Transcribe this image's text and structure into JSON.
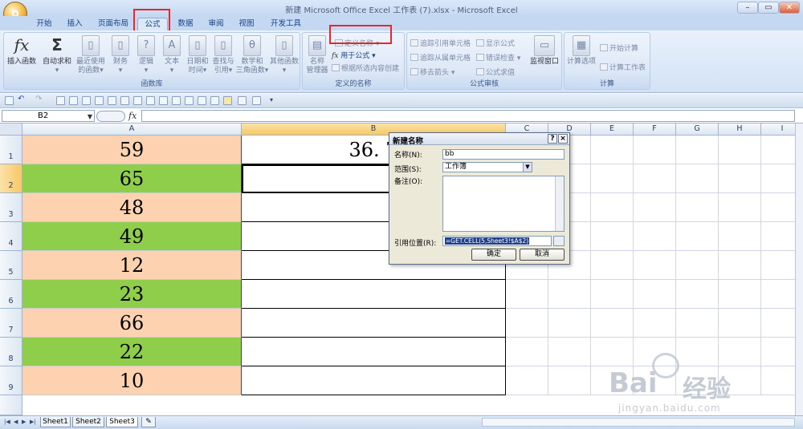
{
  "window": {
    "title": "新建 Microsoft Office Excel 工作表 (7).xlsx - Microsoft Excel",
    "controls": [
      "–",
      "▭",
      "✕"
    ]
  },
  "office_button": {
    "label": "O"
  },
  "tabs": [
    {
      "label": "开始"
    },
    {
      "label": "插入"
    },
    {
      "label": "页面布局"
    },
    {
      "label": "公式",
      "active": true
    },
    {
      "label": "数据"
    },
    {
      "label": "审阅"
    },
    {
      "label": "视图"
    },
    {
      "label": "开发工具"
    }
  ],
  "ribbon": {
    "function_library": {
      "label": "函数库",
      "buttons": [
        {
          "line1": "插入函数",
          "line2": "",
          "icon": "fx"
        },
        {
          "line1": "自动求和",
          "line2": "▾",
          "icon": "Σ"
        },
        {
          "line1": "最近使用",
          "line2": "的函数▾",
          "icon": "▯"
        },
        {
          "line1": "财务",
          "line2": "▾",
          "icon": "▯"
        },
        {
          "line1": "逻辑",
          "line2": "▾",
          "icon": "?"
        },
        {
          "line1": "文本",
          "line2": "▾",
          "icon": "A"
        },
        {
          "line1": "日期和",
          "line2": "时间▾",
          "icon": "▯"
        },
        {
          "line1": "查找与",
          "line2": "引用▾",
          "icon": "▯"
        },
        {
          "line1": "数学和",
          "line2": "三角函数▾",
          "icon": "θ"
        },
        {
          "line1": "其他函数",
          "line2": "▾",
          "icon": "▯"
        }
      ]
    },
    "defined_names": {
      "label": "定义的名称",
      "name_manager": {
        "line1": "名称",
        "line2": "管理器"
      },
      "define_name": "定义名称 ▾",
      "use_in_formula": "用于公式 ▾",
      "create_from_selection": "根据所选内容创建"
    },
    "formula_auditing": {
      "label": "公式审核",
      "trace_precedents": "追踪引用单元格",
      "trace_dependents": "追踪从属单元格",
      "remove_arrows": "移去箭头 ▾",
      "show_formulas": "显示公式",
      "error_checking": "错误检查 ▾",
      "evaluate_formula": "公式求值",
      "watch_window": "监视窗口"
    },
    "calculation": {
      "label": "计算",
      "calc_options": "计算选项",
      "calc_now": "开始计算",
      "calc_sheet": "计算工作表"
    }
  },
  "formula_bar": {
    "name_box": "B2",
    "fx": "fx",
    "formula": ""
  },
  "columns": [
    {
      "label": "A",
      "w": 273,
      "sel": false
    },
    {
      "label": "B",
      "w": 329,
      "sel": true
    },
    {
      "label": "C",
      "w": 53
    },
    {
      "label": "D",
      "w": 53
    },
    {
      "label": "E",
      "w": 53
    },
    {
      "label": "F",
      "w": 53
    },
    {
      "label": "G",
      "w": 53
    },
    {
      "label": "H",
      "w": 53
    },
    {
      "label": "I",
      "w": 53
    }
  ],
  "rows": [
    {
      "num": "1",
      "a": "59",
      "b": "36. 7",
      "color": "#fcd2b0"
    },
    {
      "num": "2",
      "a": "65",
      "b": "",
      "color": "#8fce4b"
    },
    {
      "num": "3",
      "a": "48",
      "b": "",
      "color": "#fcd2b0"
    },
    {
      "num": "4",
      "a": "49",
      "b": "",
      "color": "#8fce4b"
    },
    {
      "num": "5",
      "a": "12",
      "b": "",
      "color": "#fcd2b0"
    },
    {
      "num": "6",
      "a": "23",
      "b": "",
      "color": "#8fce4b"
    },
    {
      "num": "7",
      "a": "66",
      "b": "",
      "color": "#fcd2b0"
    },
    {
      "num": "8",
      "a": "22",
      "b": "",
      "color": "#8fce4b"
    },
    {
      "num": "9",
      "a": "10",
      "b": "",
      "color": "#fcd2b0"
    }
  ],
  "dialog": {
    "title": "新建名称",
    "help": "?",
    "close": "×",
    "name_label": "名称(N):",
    "name_value": "bb",
    "scope_label": "范围(S):",
    "scope_value": "工作簿",
    "comment_label": "备注(O):",
    "refers_label": "引用位置(R):",
    "refers_value": "=GET.CELL(5,Sheet3!$A$2)",
    "ok": "确定",
    "cancel": "取消"
  },
  "sheets": [
    {
      "label": "Sheet1"
    },
    {
      "label": "Sheet2"
    },
    {
      "label": "Sheet3",
      "active": true
    }
  ],
  "watermark": {
    "brand": "Bai",
    "brand2": "经验",
    "url": "jingyan.baidu.com"
  }
}
